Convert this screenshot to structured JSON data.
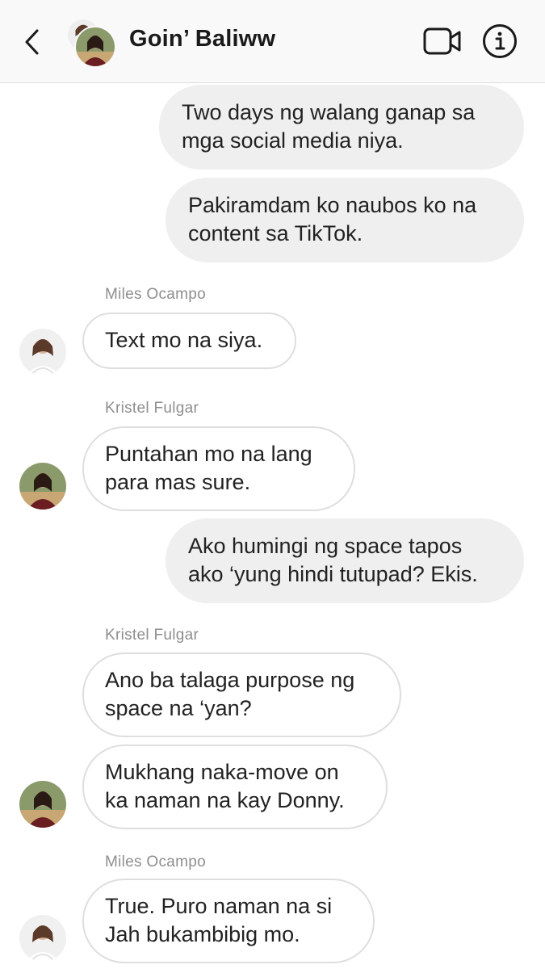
{
  "header": {
    "title": "Goin’ Baliww",
    "back_icon": "chevron-left-icon",
    "video_icon": "video-camera-icon",
    "info_icon": "info-icon"
  },
  "colors": {
    "outgoing_bubble": "#efefef",
    "incoming_border": "#dedede",
    "sender_label": "#8e8e8e",
    "header_bg": "#f9f9f9"
  },
  "messages": [
    {
      "direction": "outgoing",
      "text": "Two days ng walang ganap sa mga social media niya."
    },
    {
      "direction": "outgoing",
      "text": "Pakiramdam ko naubos ko na content sa TikTok."
    },
    {
      "direction": "incoming",
      "sender": "Miles Ocampo",
      "text": "Text mo na siya."
    },
    {
      "direction": "incoming",
      "sender": "Kristel Fulgar",
      "text": "Puntahan mo na lang para mas sure."
    },
    {
      "direction": "outgoing",
      "text": "Ako humingi ng space tapos ako ‘yung hindi tutupad? Ekis."
    },
    {
      "direction": "incoming",
      "sender": "Kristel Fulgar",
      "text": "Ano ba talaga purpose ng space na ‘yan?"
    },
    {
      "direction": "incoming",
      "text": "Mukhang naka-move on ka naman na kay Donny."
    },
    {
      "direction": "incoming",
      "sender": "Miles Ocampo",
      "text": "True. Puro naman na si Jah bukambibig mo."
    }
  ]
}
